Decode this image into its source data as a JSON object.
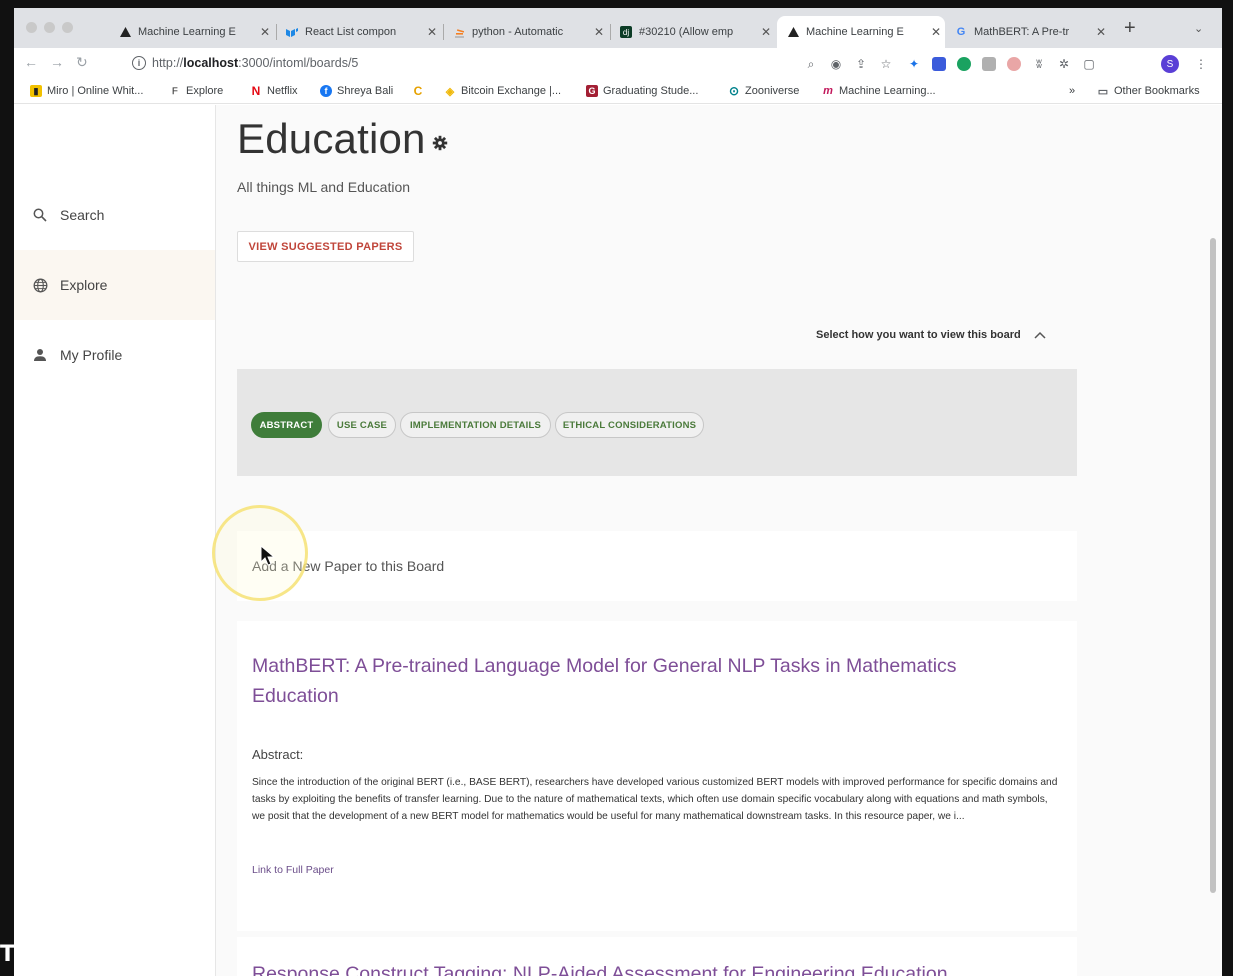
{
  "browser": {
    "tabs": [
      {
        "title": "Machine Learning E",
        "icon": "triangle-favicon"
      },
      {
        "title": "React List compon",
        "icon": "mui-favicon"
      },
      {
        "title": "python - Automatic",
        "icon": "stackoverflow-favicon"
      },
      {
        "title": "#30210 (Allow emp",
        "icon": "django-favicon"
      },
      {
        "title": "Machine Learning E",
        "icon": "triangle-favicon",
        "active": true
      },
      {
        "title": "MathBERT: A Pre-tr",
        "icon": "google-favicon"
      }
    ],
    "url_prefix": "http://",
    "url_host": "localhost",
    "url_path": ":3000/intoml/boards/5",
    "bookmarks": [
      "Miro | Online Whit...",
      "Explore",
      "Netflix",
      "Shreya Bali",
      "Bitcoin Exchange |...",
      "Graduating Stude...",
      "Zooniverse",
      "Machine Learning..."
    ],
    "bookmarks_overflow": "»",
    "other_bookmarks": "Other Bookmarks",
    "profile_initial": "S"
  },
  "sidebar": {
    "items": [
      {
        "label": "Search",
        "icon": "search-icon"
      },
      {
        "label": "Explore",
        "icon": "globe-icon"
      },
      {
        "label": "My Profile",
        "icon": "person-icon"
      }
    ]
  },
  "board": {
    "title": "Education",
    "subtitle": "All things ML and Education",
    "suggested_button": "VIEW SUGGESTED PAPERS",
    "view_toggle_label": "Select how you want to view this board",
    "view_options": [
      "ABSTRACT",
      "USE CASE",
      "IMPLEMENTATION DETAILS",
      "ETHICAL CONSIDERATIONS"
    ],
    "selected_view": "ABSTRACT",
    "add_paper_placeholder": "Add a New Paper to this Board"
  },
  "papers": [
    {
      "title": "MathBERT: A Pre-trained Language Model for General NLP Tasks in Mathematics Education",
      "abstract_label": "Abstract:",
      "abstract": "Since the introduction of the original BERT (i.e., BASE BERT), researchers have developed various customized BERT models with improved performance for specific domains and tasks by exploiting the benefits of transfer learning. Due to the nature of mathematical texts, which often use domain specific vocabulary along with equations and math symbols, we posit that the development of a new BERT model for mathematics would be useful for many mathematical downstream tasks. In this resource paper, we i...",
      "link_text": "Link to Full Paper"
    },
    {
      "title": "Response Construct Tagging: NLP-Aided Assessment for Engineering Education"
    }
  ],
  "overlay_text": "TIC",
  "colors": {
    "accent_green": "#3f7d3a",
    "paper_title": "#7e4e97",
    "suggested_red": "#c0453a"
  }
}
